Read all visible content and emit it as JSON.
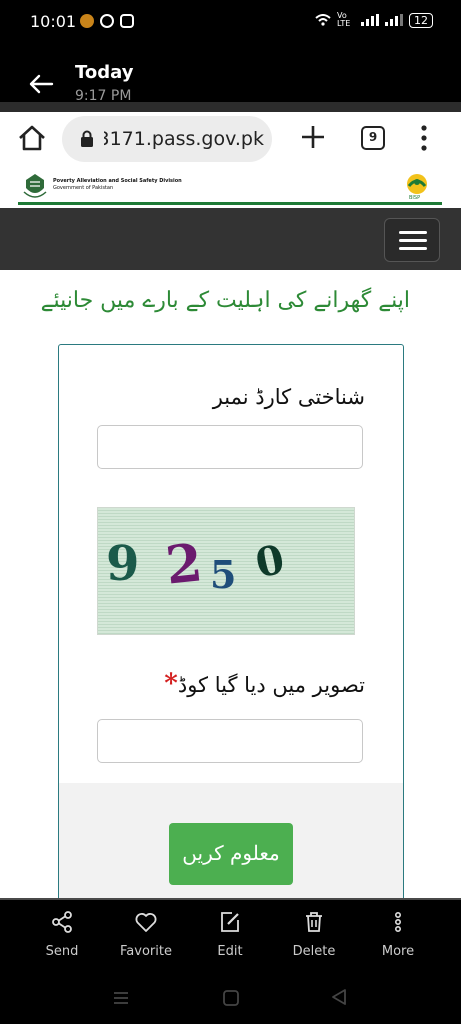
{
  "status_bar": {
    "time": "10:01",
    "volte": "Vo LTE",
    "battery": "12"
  },
  "app_header": {
    "title": "Today",
    "subtitle": "9:17 PM"
  },
  "browser": {
    "url": "3171.pass.gov.pk",
    "tab_count": "9"
  },
  "site": {
    "gov_title": "Poverty Alleviation and Social Safety Division",
    "gov_subtitle": "Government of Pakistan",
    "bisp_caption": "BISP"
  },
  "page": {
    "heading": "اپنے گھرانے کی اہلیت کے بارے میں جانیئے",
    "cnic_label": "شناختی کارڈ نمبر",
    "cnic_value": "",
    "captcha_digits": [
      "9",
      "2",
      "5",
      "0"
    ],
    "captcha_label": "تصویر میں دیا گیا کوڈ",
    "required_mark": "*",
    "captcha_value": "",
    "submit_label": "معلوم کریں"
  },
  "actions": [
    {
      "label": "Send",
      "icon": "share-icon"
    },
    {
      "label": "Favorite",
      "icon": "heart-icon"
    },
    {
      "label": "Edit",
      "icon": "edit-icon"
    },
    {
      "label": "Delete",
      "icon": "trash-icon"
    },
    {
      "label": "More",
      "icon": "more-icon"
    }
  ],
  "colors": {
    "accent_green": "#2d8a36",
    "button_green": "#4caf50",
    "navbar": "#333333"
  }
}
